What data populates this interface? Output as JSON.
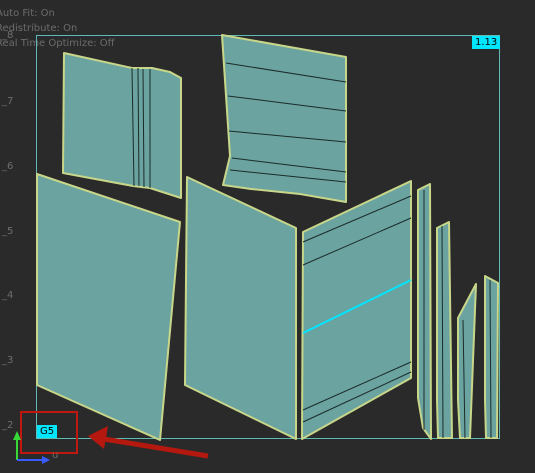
{
  "status": {
    "auto_fit": "Auto Fit: On",
    "redistribute": "Redistribute: On",
    "realtime_optimize": "Real Time Optimize: Off"
  },
  "ruler": {
    "ticks": [
      "_8",
      "_7",
      "_6",
      "_5",
      "_4",
      "_3",
      "_2"
    ]
  },
  "badges": {
    "uv_density": "1.13",
    "grid_tile": "G5"
  },
  "axes": {
    "u_label": "u"
  },
  "colors": {
    "background": "#2a2a2a",
    "island_fill": "#6aa39f",
    "island_edge": "#c8d68a",
    "selected_edge": "#00e6ff",
    "annotation_red": "#c0180e"
  }
}
